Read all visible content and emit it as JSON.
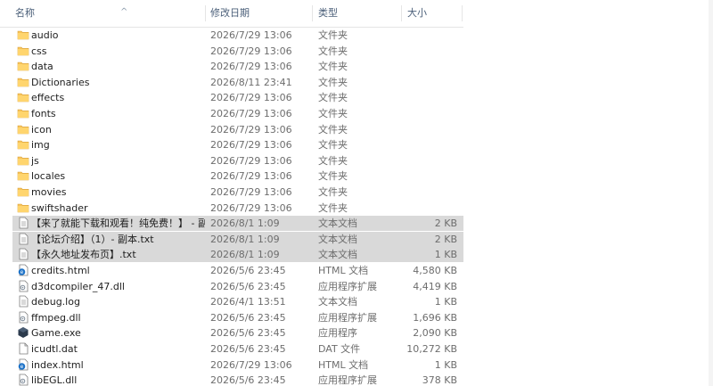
{
  "columns": {
    "name": "名称",
    "date": "修改日期",
    "type": "类型",
    "size": "大小",
    "sort_indicator": "^"
  },
  "files": [
    {
      "name": "audio",
      "date": "2026/7/29 13:06",
      "type": "文件夹",
      "size": "",
      "icon": "folder-icon",
      "selected": false
    },
    {
      "name": "css",
      "date": "2026/7/29 13:06",
      "type": "文件夹",
      "size": "",
      "icon": "folder-icon",
      "selected": false
    },
    {
      "name": "data",
      "date": "2026/7/29 13:06",
      "type": "文件夹",
      "size": "",
      "icon": "folder-icon",
      "selected": false
    },
    {
      "name": "Dictionaries",
      "date": "2026/8/11 23:41",
      "type": "文件夹",
      "size": "",
      "icon": "folder-icon",
      "selected": false
    },
    {
      "name": "effects",
      "date": "2026/7/29 13:06",
      "type": "文件夹",
      "size": "",
      "icon": "folder-icon",
      "selected": false
    },
    {
      "name": "fonts",
      "date": "2026/7/29 13:06",
      "type": "文件夹",
      "size": "",
      "icon": "folder-icon",
      "selected": false
    },
    {
      "name": "icon",
      "date": "2026/7/29 13:06",
      "type": "文件夹",
      "size": "",
      "icon": "folder-icon",
      "selected": false
    },
    {
      "name": "img",
      "date": "2026/7/29 13:06",
      "type": "文件夹",
      "size": "",
      "icon": "folder-icon",
      "selected": false
    },
    {
      "name": "js",
      "date": "2026/7/29 13:06",
      "type": "文件夹",
      "size": "",
      "icon": "folder-icon",
      "selected": false
    },
    {
      "name": "locales",
      "date": "2026/7/29 13:06",
      "type": "文件夹",
      "size": "",
      "icon": "folder-icon",
      "selected": false
    },
    {
      "name": "movies",
      "date": "2026/7/29 13:06",
      "type": "文件夹",
      "size": "",
      "icon": "folder-icon",
      "selected": false
    },
    {
      "name": "swiftshader",
      "date": "2026/7/29 13:06",
      "type": "文件夹",
      "size": "",
      "icon": "folder-icon",
      "selected": false
    },
    {
      "name": "【来了就能下载和观看！纯免费！】 - 副...",
      "date": "2026/8/1 1:09",
      "type": "文本文档",
      "size": "2 KB",
      "icon": "text-file-icon",
      "selected": true
    },
    {
      "name": "【论坛介绍】（1）- 副本.txt",
      "date": "2026/8/1 1:09",
      "type": "文本文档",
      "size": "2 KB",
      "icon": "text-file-icon",
      "selected": true
    },
    {
      "name": "【永久地址发布页】.txt",
      "date": "2026/8/1 1:09",
      "type": "文本文档",
      "size": "1 KB",
      "icon": "text-file-icon",
      "selected": true
    },
    {
      "name": "credits.html",
      "date": "2026/5/6 23:45",
      "type": "HTML 文档",
      "size": "4,580 KB",
      "icon": "html-file-icon",
      "selected": false
    },
    {
      "name": "d3dcompiler_47.dll",
      "date": "2026/5/6 23:45",
      "type": "应用程序扩展",
      "size": "4,419 KB",
      "icon": "dll-file-icon",
      "selected": false
    },
    {
      "name": "debug.log",
      "date": "2026/4/1 13:51",
      "type": "文本文档",
      "size": "1 KB",
      "icon": "text-file-icon",
      "selected": false
    },
    {
      "name": "ffmpeg.dll",
      "date": "2026/5/6 23:45",
      "type": "应用程序扩展",
      "size": "1,696 KB",
      "icon": "dll-file-icon",
      "selected": false
    },
    {
      "name": "Game.exe",
      "date": "2026/5/6 23:45",
      "type": "应用程序",
      "size": "2,090 KB",
      "icon": "game-exe-icon",
      "selected": false
    },
    {
      "name": "icudtl.dat",
      "date": "2026/5/6 23:45",
      "type": "DAT 文件",
      "size": "10,272 KB",
      "icon": "blank-file-icon",
      "selected": false
    },
    {
      "name": "index.html",
      "date": "2026/7/29 13:06",
      "type": "HTML 文档",
      "size": "1 KB",
      "icon": "html-file-icon",
      "selected": false
    },
    {
      "name": "libEGL.dll",
      "date": "2026/5/6 23:45",
      "type": "应用程序扩展",
      "size": "378 KB",
      "icon": "dll-file-icon",
      "selected": false
    }
  ],
  "colors": {
    "folder": "#f7c35a",
    "selection": "#d9d9d9",
    "header_text": "#4c607a",
    "edge_blue": "#1e73c8"
  }
}
